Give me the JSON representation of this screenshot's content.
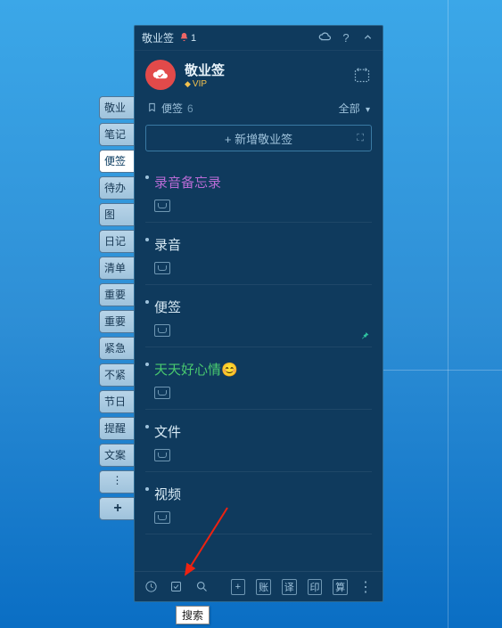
{
  "titlebar": {
    "app_name": "敬业签",
    "bell_count": "1"
  },
  "header": {
    "title": "敬业签",
    "vip": "VIP"
  },
  "section": {
    "icon_label": "便签",
    "count": "6",
    "filter_label": "全部"
  },
  "add_button": {
    "label": "+ 新增敬业签"
  },
  "side_tabs": [
    "敬业",
    "笔记",
    "便签",
    "待办",
    "图",
    "日记",
    "清单",
    "重要",
    "重要",
    "紧急",
    "不紧",
    "节日",
    "提醒",
    "文案"
  ],
  "side_active_index": 2,
  "notes": [
    {
      "title": "录音备忘录",
      "color": "purple",
      "attach": true
    },
    {
      "title": "录音",
      "color": "",
      "attach": true
    },
    {
      "title": "便签",
      "color": "",
      "attach": true
    },
    {
      "title": "天天好心情😊",
      "color": "green",
      "attach": true
    },
    {
      "title": "文件",
      "color": "",
      "attach": true
    },
    {
      "title": "视频",
      "color": "",
      "attach": true
    }
  ],
  "footer": {
    "sq1": "+",
    "sq2": "账",
    "sq3": "译",
    "sq4": "印",
    "sq5": "算"
  },
  "tooltip": "搜索"
}
